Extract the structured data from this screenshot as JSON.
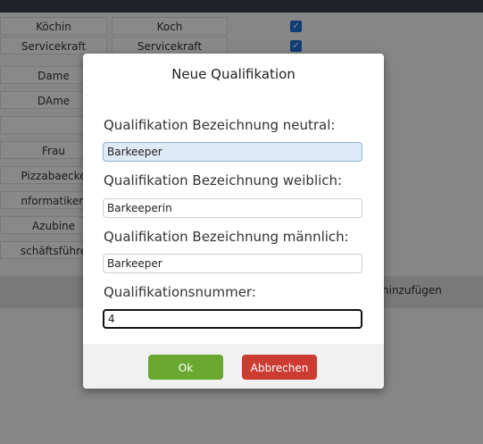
{
  "background": {
    "rows": [
      {
        "col1": "Köchin",
        "col2": "Koch",
        "checked": true
      },
      {
        "col1": "Servicekraft",
        "col2": "Servicekraft",
        "checked": true
      },
      {
        "col1": "Dame",
        "col2": "",
        "checked": false
      },
      {
        "col1": "DAme",
        "col2": "",
        "checked": false
      },
      {
        "col1": "",
        "col2": "",
        "checked": false
      },
      {
        "col1": "Frau",
        "col2": "",
        "checked": false
      },
      {
        "col1": "Pizzabaecke",
        "col2": "",
        "checked": false
      },
      {
        "col1": "nformatikeri",
        "col2": "",
        "checked": false
      },
      {
        "col1": "Azubine",
        "col2": "",
        "checked": false
      },
      {
        "col1": "schäftsführe",
        "col2": "",
        "checked": false
      }
    ],
    "add_text": "hinzufügen"
  },
  "modal": {
    "title": "Neue Qualifikation",
    "fields": {
      "neutral": {
        "label": "Qualifikation Bezeichnung neutral:",
        "value": "Barkeeper"
      },
      "weiblich": {
        "label": "Qualifikation Bezeichnung weiblich:",
        "value": "Barkeeperin"
      },
      "maennlich": {
        "label": "Qualifikation Bezeichnung männlich:",
        "value": "Barkeeper"
      },
      "nummer": {
        "label": "Qualifikationsnummer:",
        "value": "4"
      }
    },
    "ok_label": "Ok",
    "cancel_label": "Abbrechen"
  },
  "colors": {
    "ok": "#6aa832",
    "cancel": "#cc3c32",
    "checkbox": "#1f6fd8"
  }
}
